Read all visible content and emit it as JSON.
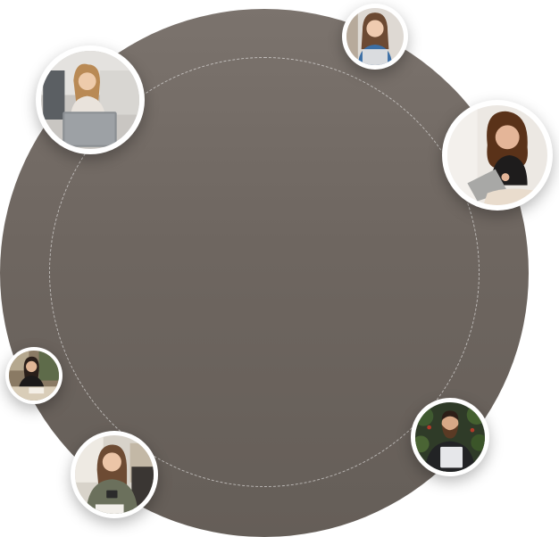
{
  "scene": {
    "colors": {
      "circle": "#6e6660",
      "ring": "#ffffff",
      "frame": "#ffffff"
    },
    "avatars": [
      {
        "name": "avatar-woman-laptop-couch"
      },
      {
        "name": "avatar-woman-smiling-laptop"
      },
      {
        "name": "avatar-woman-curly-laptop"
      },
      {
        "name": "avatar-woman-desk-writing"
      },
      {
        "name": "avatar-woman-holding-phone"
      },
      {
        "name": "avatar-man-beard-holding-tablet"
      }
    ]
  }
}
